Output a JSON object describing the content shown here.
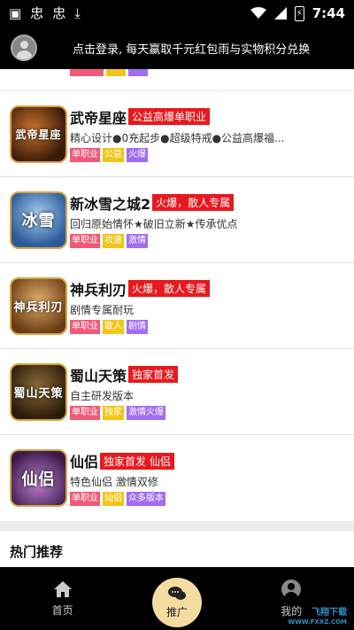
{
  "status_bar": {
    "time": "7:44",
    "icons": [
      "image-icon",
      "bug-icon",
      "bug-icon",
      "download-icon",
      "wifi-icon",
      "signal-icon",
      "battery-charging-icon"
    ]
  },
  "header": {
    "login_text": "点击登录, 每天赢取千元红包雨与实物积分兑换"
  },
  "games": [
    {
      "title": "武帝星座",
      "badge": "公益高爆单职业",
      "desc": "精心设计●0充起步●超级特戒●公益高爆福...",
      "icon_text": "武帝星座",
      "tags": [
        {
          "label": "单职业",
          "color": "#f05a78"
        },
        {
          "label": "公益",
          "color": "#f2c617"
        },
        {
          "label": "火爆",
          "color": "#a26cf0"
        }
      ]
    },
    {
      "title": "新冰雪之城2",
      "badge": "火爆，散人专属",
      "desc": "回归原始情怀★破旧立新★传承优点",
      "icon_text": "冰雪",
      "tags": [
        {
          "label": "单职业",
          "color": "#f05a78"
        },
        {
          "label": "攻速",
          "color": "#f2c617"
        },
        {
          "label": "激情",
          "color": "#a26cf0"
        }
      ]
    },
    {
      "title": "神兵利刃",
      "badge": "火爆，散人专属",
      "desc": "剧情专属耐玩",
      "icon_text": "神兵利刃",
      "tags": [
        {
          "label": "单职业",
          "color": "#f05a78"
        },
        {
          "label": "散人",
          "color": "#f2c617"
        },
        {
          "label": "剧情",
          "color": "#a26cf0"
        }
      ]
    },
    {
      "title": "蜀山天策",
      "badge": "独家首发",
      "desc": "自主研发版本",
      "icon_text": "蜀山天策",
      "tags": [
        {
          "label": "单职业",
          "color": "#f05a78"
        },
        {
          "label": "独家",
          "color": "#f2c617"
        },
        {
          "label": "激情火爆",
          "color": "#a26cf0"
        }
      ]
    },
    {
      "title": "仙侣",
      "badge": "独家首发 仙侣",
      "desc": "特色仙侣 激情双修",
      "icon_text": "仙侣",
      "tags": [
        {
          "label": "单职业",
          "color": "#f05a78"
        },
        {
          "label": "仙侣",
          "color": "#f2c617"
        },
        {
          "label": "众多版本",
          "color": "#a26cf0"
        }
      ]
    }
  ],
  "section": {
    "title": "热门推荐"
  },
  "bottom_nav": {
    "home": "首页",
    "promote": "推广",
    "mine": "我的"
  },
  "watermark": {
    "line1": "飞翔下载",
    "line2": "WWW.FXXZ.COM"
  }
}
